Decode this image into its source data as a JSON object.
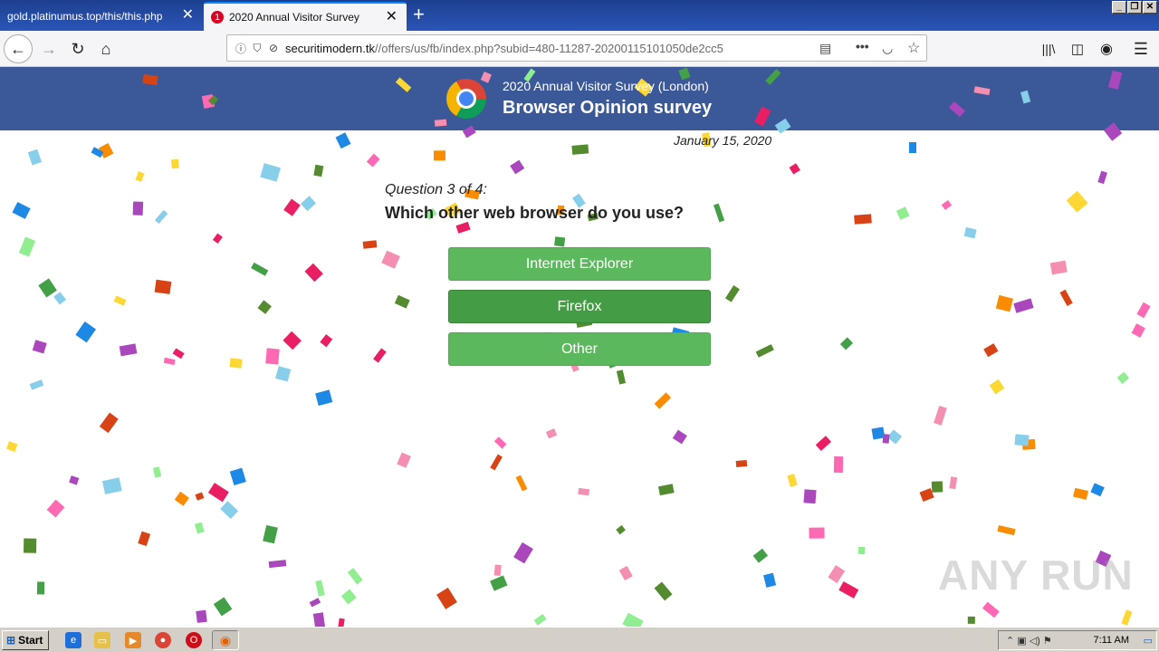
{
  "browser": {
    "tabs": [
      {
        "title": "gold.platinumus.top/this/this.php",
        "active": false
      },
      {
        "title": "2020 Annual Visitor Survey",
        "active": true,
        "badge": "1"
      }
    ],
    "url": {
      "host": "securitimodern.tk",
      "path": "//offers/us/fb/index.php?subid=480-11287-20200115101050de2cc5"
    },
    "window_buttons": [
      "_",
      "❐",
      "✕"
    ]
  },
  "page": {
    "banner_subtitle": "2020 Annual Visitor Survey (London)",
    "banner_title": "Browser Opinion survey",
    "date": "January 15, 2020",
    "question_number": "Question 3 of 4:",
    "question": "Which other web browser do you use?",
    "answers": [
      "Internet Explorer",
      "Firefox",
      "Other"
    ],
    "colors": {
      "banner": "#3b5998",
      "button": "#5cb85c",
      "button_hover": "#449d44"
    }
  },
  "watermark": "ANY RUN",
  "taskbar": {
    "start_label": "Start",
    "clock": "7:11 AM",
    "pinned_icons": [
      "ie-icon",
      "folder-icon",
      "media-player-icon",
      "chrome-icon",
      "opera-icon",
      "firefox-icon"
    ]
  }
}
